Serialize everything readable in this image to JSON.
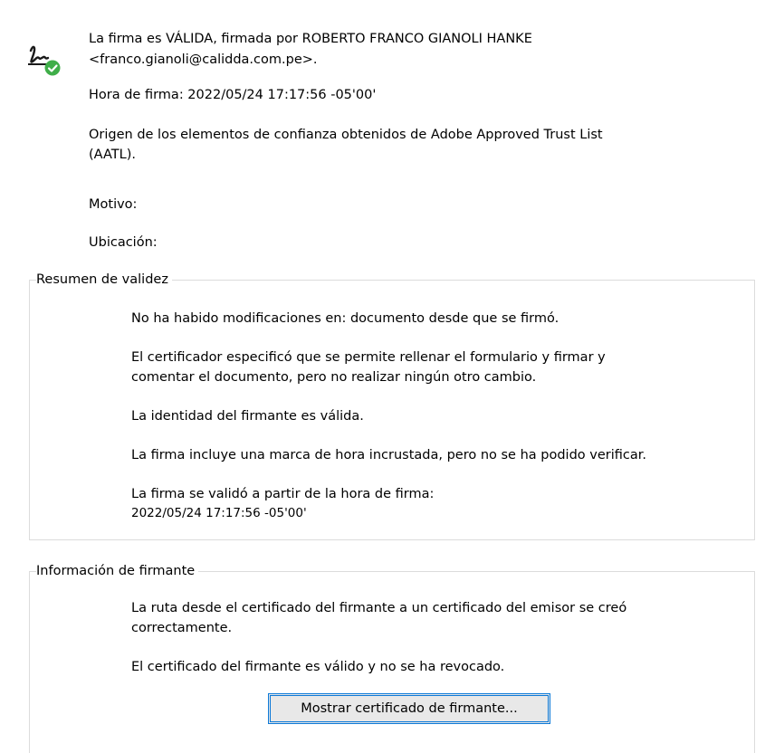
{
  "header": {
    "signature_status_line1": "La firma es VÁLIDA, firmada por ROBERTO FRANCO GIANOLI HANKE",
    "signature_status_line2": "<franco.gianoli@calidda.com.pe>.",
    "signing_time": "Hora de firma:  2022/05/24 17:17:56 -05'00'",
    "trust_origin_line1": "Origen de los elementos de confianza obtenidos de Adobe Approved Trust List",
    "trust_origin_line2": "(AATL).",
    "reason_label": "Motivo:",
    "location_label": "Ubicación:",
    "icon": "signature-valid-icon"
  },
  "validity_summary": {
    "legend": "Resumen de validez",
    "no_modifications": "No ha habido modificaciones en: documento desde que se firmó.",
    "certifier_line1": "El certificador especificó que se permite rellenar el formulario y firmar y",
    "certifier_line2": "comentar el documento, pero no realizar ningún otro cambio.",
    "identity_valid": "La identidad del firmante es válida.",
    "timestamp_line": "La firma incluye una marca de hora incrustada, pero no se ha podido verificar.",
    "validated_line1": "La firma se validó a partir de la hora de firma:",
    "validated_line2": "2022/05/24 17:17:56 -05'00'"
  },
  "signer_info": {
    "legend": "Información de firmante",
    "path_line1": "La ruta desde el certificado del firmante a un certificado del emisor se creó",
    "path_line2": "correctamente.",
    "cert_valid": "El certificado del firmante es válido y no se ha revocado.",
    "show_cert_button": "Mostrar certificado de firmante..."
  },
  "colors": {
    "check_green": "#3fae49",
    "border": "#dcdcdc",
    "button_focus": "#0a78d7"
  }
}
